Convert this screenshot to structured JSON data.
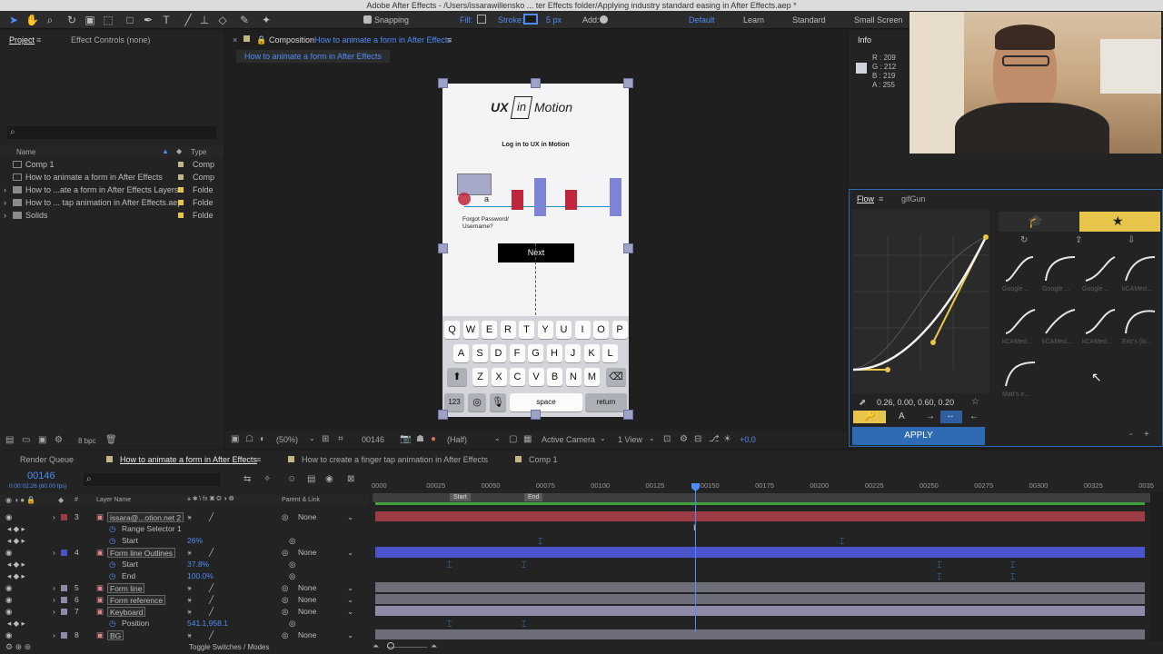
{
  "window": {
    "title": "Adobe After Effects - /Users/issarawillensko ... ter Effects folder/Applying industry standard easing in After Effects.aep *"
  },
  "toolbar": {
    "snapping_label": "Snapping",
    "fill_label": "Fill:",
    "stroke_label": "Stroke:",
    "stroke_size": "5 px",
    "add_label": "Add:",
    "workspaces": [
      "Default",
      "Learn",
      "Standard",
      "Small Screen"
    ]
  },
  "project": {
    "tab_project": "Project",
    "tab_effect_controls": "Effect Controls (none)",
    "search_placeholder": "",
    "col_name": "Name",
    "col_type": "Type",
    "items": [
      {
        "name": "Comp 1",
        "type": "Comp"
      },
      {
        "name": "How to animate a form in After Effects",
        "type": "Comp"
      },
      {
        "name": "How to ...ate a form in After Effects Layers",
        "type": "Folde"
      },
      {
        "name": "How to ... tap animation in After Effects.aep",
        "type": "Folde"
      },
      {
        "name": "Solids",
        "type": "Folde"
      }
    ],
    "bpc": "8 bpc"
  },
  "composition": {
    "tab_prefix": "Composition",
    "tab_name": "How to animate a form in After Effects",
    "breadcrumb": "How to animate a form in After Effects",
    "zoom": "(50%)",
    "timecode": "00146",
    "resolution": "(Half)",
    "camera": "Active Camera",
    "view": "1 View",
    "exposure": "+0.0"
  },
  "mockup": {
    "logo_ux": "UX",
    "logo_in": "in",
    "logo_motion": "Motion",
    "login_title": "Log in to UX in Motion",
    "cursor_char": "a",
    "forgot_line1": "Forgot Password/",
    "forgot_line2": "Username?",
    "next_button": "Next",
    "keyboard_rows": [
      [
        "Q",
        "W",
        "E",
        "R",
        "T",
        "Y",
        "U",
        "I",
        "O",
        "P"
      ],
      [
        "A",
        "S",
        "D",
        "F",
        "G",
        "H",
        "J",
        "K",
        "L"
      ],
      [
        "Z",
        "X",
        "C",
        "V",
        "B",
        "N",
        "M"
      ]
    ],
    "key_123": "123",
    "key_space": "space",
    "key_return": "return"
  },
  "info": {
    "title": "Info",
    "r": "R : 209",
    "g": "G : 212",
    "b": "B : 219",
    "a": "A : 255"
  },
  "flow": {
    "tab_flow": "Flow",
    "tab_gifgun": "gifGun",
    "bezier_values": "0.26, 0.00, 0.60, 0.20",
    "apply_label": "APPLY",
    "presets": [
      {
        "name": "Google ..."
      },
      {
        "name": "Google ..."
      },
      {
        "name": "Google ..."
      },
      {
        "name": "kCAMed..."
      },
      {
        "name": "kCAMed..."
      },
      {
        "name": "kCAMed..."
      },
      {
        "name": "kCAMed..."
      },
      {
        "name": "Eric's (lo..."
      },
      {
        "name": "Matt's e..."
      }
    ],
    "bottom_minus": "-",
    "bottom_plus": "+"
  },
  "timeline": {
    "tab_render_queue": "Render Queue",
    "tabs": [
      "How to animate a form in After Effects",
      "How to create a finger tap animation in After Effects",
      "Comp 1"
    ],
    "current_time": "00146",
    "current_time_sub": "0:00:02:26 (60.00 fps)",
    "col_layer_name": "Layer Name",
    "col_parent": "Parent & Link",
    "ruler": [
      "0000",
      "00025",
      "00050",
      "00075",
      "00100",
      "00125",
      "00150",
      "00175",
      "00200",
      "00225",
      "00250",
      "00275",
      "00300",
      "00325",
      "0035"
    ],
    "marker_start": "Start",
    "marker_end": "End",
    "rows": [
      {
        "num": "3",
        "name": "issara@...otion.net 2",
        "parent": "None"
      },
      {
        "num": "",
        "name": "Range Selector 1",
        "parent": ""
      },
      {
        "num": "",
        "name": "Start",
        "value": "26%"
      },
      {
        "num": "4",
        "name": "Form line Outlines",
        "parent": "None"
      },
      {
        "num": "",
        "name": "Start",
        "value": "37.8%"
      },
      {
        "num": "",
        "name": "End",
        "value": "100.0%"
      },
      {
        "num": "5",
        "name": "Form line",
        "parent": "None"
      },
      {
        "num": "6",
        "name": "Form reference",
        "parent": "None"
      },
      {
        "num": "7",
        "name": "Keyboard",
        "parent": "None"
      },
      {
        "num": "",
        "name": "Position",
        "value": "541.1,958.1"
      },
      {
        "num": "8",
        "name": "BG",
        "parent": "None"
      }
    ],
    "toggle_label": "Toggle Switches / Modes"
  }
}
